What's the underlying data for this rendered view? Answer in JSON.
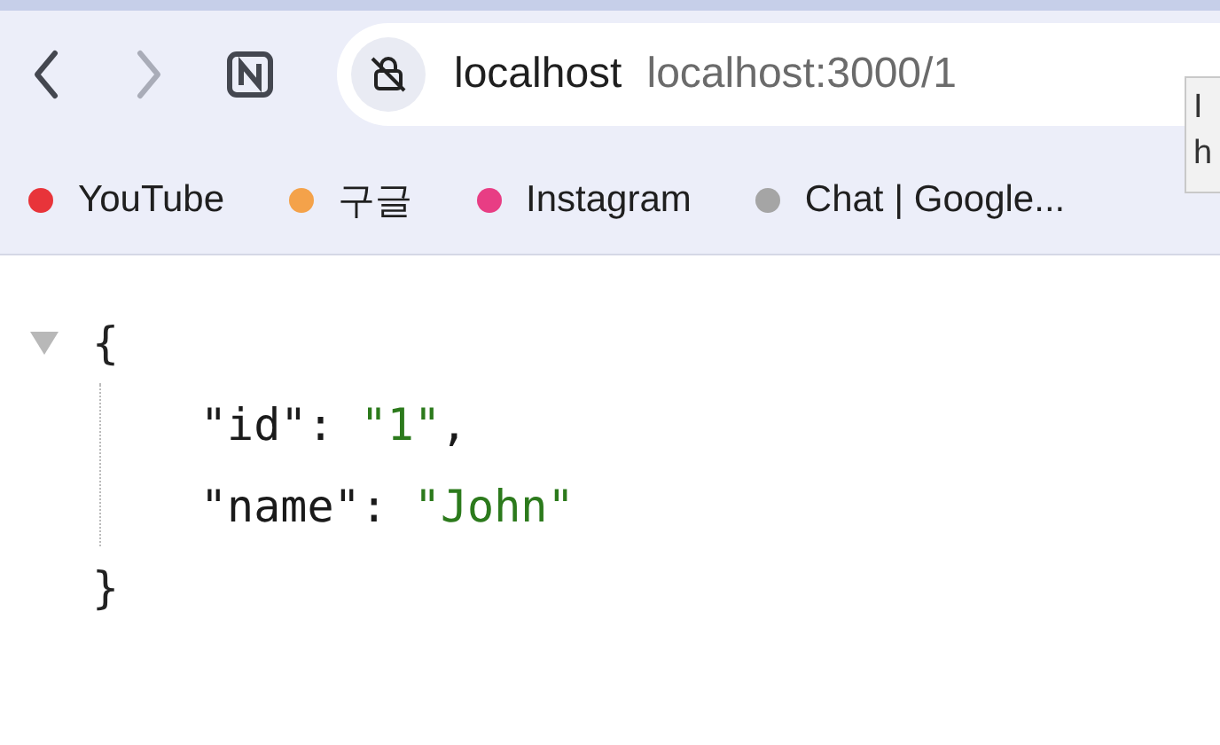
{
  "toolbar": {
    "nav": [
      {
        "kind": "back",
        "disabled": false
      },
      {
        "kind": "forward",
        "disabled": true
      }
    ],
    "address": {
      "site": "localhost",
      "url": "localhost:3000/1"
    }
  },
  "bookmarks": [
    {
      "label": "YouTube",
      "color": "#e8343a"
    },
    {
      "label": "구글",
      "color": "#f4a24a"
    },
    {
      "label": "Instagram",
      "color": "#e83d84"
    },
    {
      "label": "Chat | Google...",
      "color": "#a5a5a5"
    }
  ],
  "tooltip": {
    "lines": [
      "I",
      "h"
    ]
  },
  "viewer": {
    "expanded": true,
    "open": "{",
    "close": "}",
    "entries": [
      {
        "key": "\"id\"",
        "colon": ":",
        "value": "\"1\"",
        "comma": ","
      },
      {
        "key": "\"name\"",
        "colon": ":",
        "value": "\"John\""
      }
    ]
  }
}
